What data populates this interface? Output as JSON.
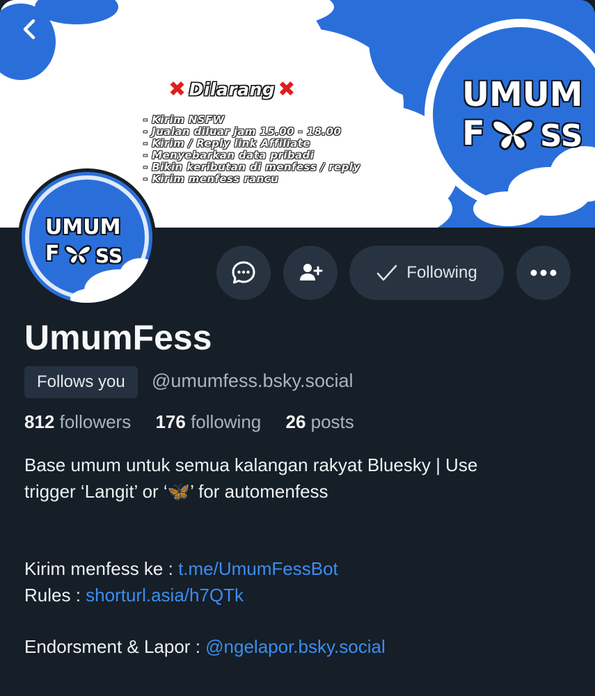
{
  "banner": {
    "rules_title": "Dilarang",
    "rules": [
      "- Kirim NSFW",
      "- Jualan diluar jam 15.00 - 18.00",
      "- Kirim / Reply link Affiliate",
      "- Menyebarkan data pribadi",
      "- Bikin keributan di menfess / reply",
      "- Kirim menfess rancu"
    ],
    "logo_line1": "UMUM",
    "logo_line2_left": "F",
    "logo_line2_right": "SS"
  },
  "avatar": {
    "logo_line1": "UMUM",
    "logo_line2_left": "F",
    "logo_line2_right": "SS"
  },
  "actions": {
    "following_label": "Following"
  },
  "profile": {
    "display_name": "UmumFess",
    "follows_you": "Follows you",
    "handle": "@umumfess.bsky.social"
  },
  "stats": {
    "followers_count": "812",
    "followers_label": "followers",
    "following_count": "176",
    "following_label": "following",
    "posts_count": "26",
    "posts_label": "posts"
  },
  "bio": {
    "line1": "Base umum untuk semua kalangan rakyat Bluesky | Use",
    "line2": "trigger ‘Langit’ or ‘🦋’ for automenfess",
    "kirim_label": "Kirim menfess ke : ",
    "kirim_link": "t.me/UmumFessBot",
    "rules_label": "Rules : ",
    "rules_link": "shorturl.asia/h7QTk",
    "endorse_label": "Endorsment & Lapor : ",
    "endorse_link": "@ngelapor.bsky.social"
  },
  "colors": {
    "background": "#161e27",
    "banner_blue": "#2a6fd9",
    "button_bg": "#273341",
    "link": "#3b8ef0",
    "muted_text": "#aab4bf"
  }
}
